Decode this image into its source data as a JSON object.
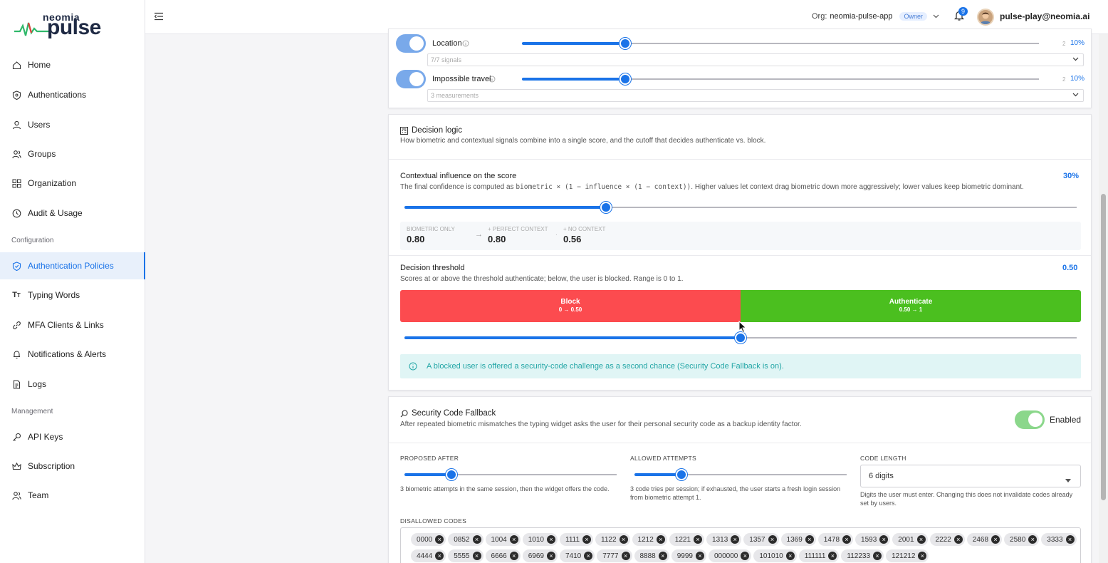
{
  "brand": {
    "top": "neomia",
    "main": "pulse"
  },
  "sidebar": {
    "items": [
      {
        "label": "Home",
        "icon": "home-icon"
      },
      {
        "label": "Authentications",
        "icon": "shield-icon"
      },
      {
        "label": "Users",
        "icon": "user-icon"
      },
      {
        "label": "Groups",
        "icon": "group-icon"
      },
      {
        "label": "Organization",
        "icon": "grid-icon"
      },
      {
        "label": "Audit & Usage",
        "icon": "clock-icon"
      }
    ],
    "section_config": "Configuration",
    "config_items": [
      {
        "label": "Authentication Policies",
        "icon": "shield-check-icon"
      },
      {
        "label": "Typing Words",
        "icon": "text-icon"
      },
      {
        "label": "MFA Clients & Links",
        "icon": "link-icon"
      },
      {
        "label": "Notifications & Alerts",
        "icon": "bell-icon"
      },
      {
        "label": "Logs",
        "icon": "file-icon"
      }
    ],
    "section_management": "Management",
    "management_items": [
      {
        "label": "API Keys",
        "icon": "key-icon"
      },
      {
        "label": "Subscription",
        "icon": "crown-icon"
      },
      {
        "label": "Team",
        "icon": "team-icon"
      }
    ]
  },
  "header": {
    "org_label": "Org:",
    "org_name": "neomia-pulse-app",
    "org_role": "Owner",
    "notif_count": "9",
    "user_email": "pulse-play@neomia.ai"
  },
  "signals": {
    "location": {
      "label": "Location",
      "max": "2",
      "percent": "10%",
      "select": "7/7 signals",
      "level": 0.2
    },
    "travel": {
      "label": "Impossible travel",
      "max": "2",
      "percent": "10%",
      "select": "3 measurements",
      "level": 0.2
    }
  },
  "decision": {
    "title": "Decision logic",
    "desc": "How biometric and contextual signals combine into a single score, and the cutoff that decides authenticate vs. block.",
    "influence_title": "Contextual influence on the score",
    "influence_value": "30%",
    "influence_level": 0.3,
    "influence_desc_pre": "The final confidence is computed as",
    "influence_formula": "biometric × (1 − influence × (1 − context))",
    "influence_desc_post": ". Higher values let context drag biometric down more aggressively; lower values keep biometric dominant.",
    "bio_only_label": "BIOMETRIC ONLY",
    "bio_only_value": "0.80",
    "perfect_label": "+ PERFECT CONTEXT",
    "perfect_value": "0.80",
    "no_context_label": "+ NO CONTEXT",
    "no_context_value": "0.56",
    "threshold_title": "Decision threshold",
    "threshold_value": "0.50",
    "threshold_level": 0.5,
    "threshold_desc": "Scores at or above the threshold authenticate; below, the user is blocked. Range is 0 to 1.",
    "block_label": "Block",
    "block_range": "0 → 0.50",
    "auth_label": "Authenticate",
    "auth_range": "0.50 → 1",
    "info_text": "A blocked user is offered a security-code challenge as a second chance (Security Code Fallback is on).",
    "colors": {
      "block": "#fc4b4f",
      "auth": "#4bbf1f",
      "info_bg": "#e0f5f5",
      "info_text": "#23a6a6"
    }
  },
  "fallback": {
    "title": "Security Code Fallback",
    "desc": "After repeated biometric mismatches the typing widget asks the user for their personal security code as a backup identity factor.",
    "toggle_label": "Enabled",
    "proposed_label": "PROPOSED AFTER",
    "proposed_desc": "3 biometric attempts in the same session, then the widget offers the code.",
    "proposed_level": 0.22,
    "attempts_label": "ALLOWED ATTEMPTS",
    "attempts_desc": "3 code tries per session; if exhausted, the user starts a fresh login session from biometric attempt 1.",
    "attempts_level": 0.22,
    "code_length_label": "CODE LENGTH",
    "code_length_value": "6 digits",
    "code_length_desc": "Digits the user must enter. Changing this does not invalidate codes already set by users.",
    "disallowed_label": "DISALLOWED CODES",
    "codes": [
      "0000",
      "0852",
      "1004",
      "1010",
      "1111",
      "1122",
      "1212",
      "1221",
      "1313",
      "1357",
      "1369",
      "1478",
      "1593",
      "2001",
      "2222",
      "2468",
      "2580",
      "3333",
      "4444",
      "5555",
      "6666",
      "6969",
      "7410",
      "7777",
      "8888",
      "9999",
      "000000",
      "101010",
      "111111",
      "112233",
      "121212"
    ]
  }
}
